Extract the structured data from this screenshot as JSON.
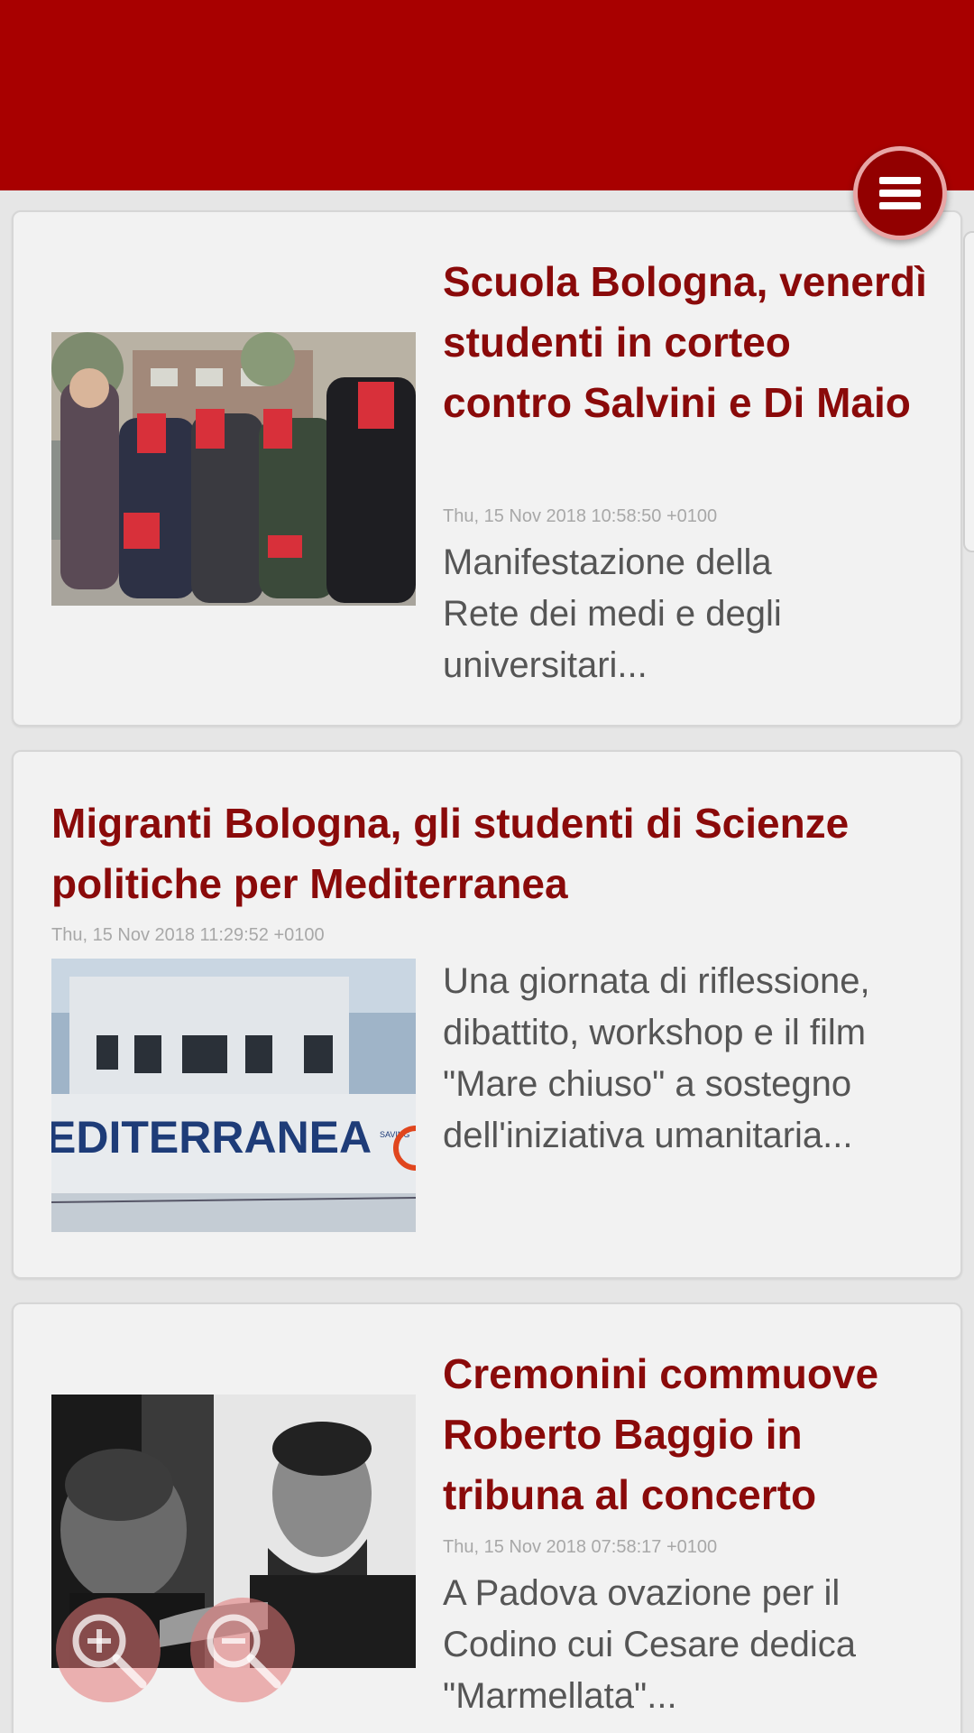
{
  "header": {
    "menu_icon": "hamburger-menu-icon",
    "brand_color": "#a80000"
  },
  "articles": [
    {
      "title": "Scuola Bologna, venerdì studenti in corteo contro Salvini e Di Maio",
      "date": "Thu, 15 Nov 2018 10:58:50 +0100",
      "excerpt": "Manifestazione della Rete dei medi e degli universitari..."
    },
    {
      "title": "Migranti Bologna, gli studenti di Scienze politiche per Mediterranea",
      "date": "Thu, 15 Nov 2018 11:29:52 +0100",
      "excerpt": "Una giornata di riflessione, dibattito, workshop e il film \"Mare chiuso\" a sostegno dell'iniziativa umanitaria...",
      "image_text": "EDITERRANEA",
      "image_small_text": "SAVING"
    },
    {
      "title": "Cremonini commuove Roberto Baggio in tribuna al concerto",
      "date": "Thu, 15 Nov 2018 07:58:17 +0100",
      "excerpt": "A Padova ovazione per il Codino cui Cesare dedica \"Marmellata\"..."
    }
  ],
  "zoom": {
    "zoom_in_icon": "zoom-in-icon",
    "zoom_out_icon": "zoom-out-icon"
  }
}
